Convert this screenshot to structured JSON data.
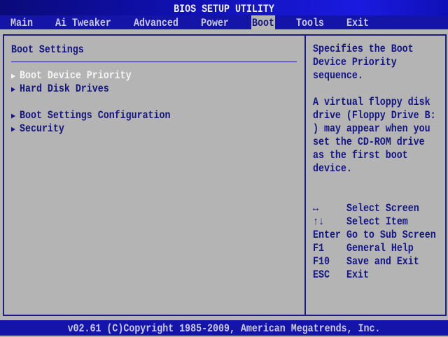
{
  "title": "BIOS SETUP UTILITY",
  "menu": [
    "Main",
    "Ai Tweaker",
    "Advanced",
    "Power",
    "Boot",
    "Tools",
    "Exit"
  ],
  "selected_menu": "Boot",
  "section_title": "Boot Settings",
  "items": [
    {
      "label": "Boot Device Priority"
    },
    {
      "label": "Hard Disk Drives"
    },
    {
      "label": "Boot Settings Configuration"
    },
    {
      "label": "Security"
    }
  ],
  "help": {
    "lines": [
      "Specifies the Boot",
      "Device Priority",
      "sequence.",
      "",
      "A virtual floppy disk",
      "drive (Floppy Drive B:",
      ") may appear when you",
      "set the CD-ROM drive",
      "as the first boot",
      "device."
    ]
  },
  "keys": [
    {
      "key": "↔",
      "action": "Select Screen"
    },
    {
      "key": "↑↓",
      "action": "Select Item"
    },
    {
      "key": "Enter",
      "action": "Go to Sub Screen"
    },
    {
      "key": "F1",
      "action": "General Help"
    },
    {
      "key": "F10",
      "action": "Save and Exit"
    },
    {
      "key": "ESC",
      "action": "Exit"
    }
  ],
  "footer": "v02.61 (C)Copyright 1985-2009, American Megatrends, Inc.",
  "colors": {
    "blue": "#1414a8",
    "gray": "#b4b4b4",
    "text": "#14147f"
  }
}
